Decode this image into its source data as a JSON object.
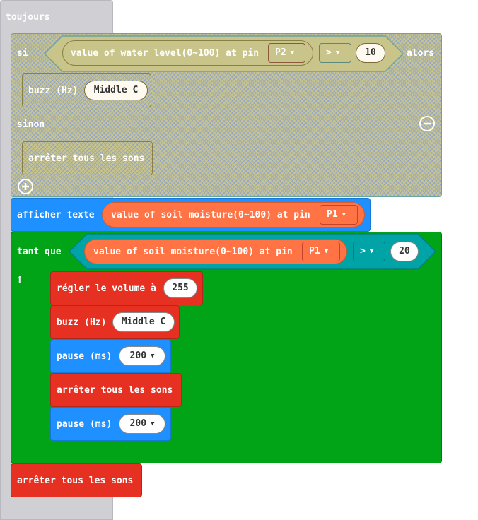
{
  "blocks": {
    "forever": {
      "label": "toujours"
    },
    "if_block": {
      "if_label": "si",
      "then_label": "alors",
      "else_label": "sinon",
      "condition": {
        "sensor_label": "value of water level(0~100) at pin",
        "pin": "P2",
        "operator": ">",
        "value": "10"
      },
      "then_buzz": {
        "label": "buzz (Hz)",
        "note": "Middle C"
      },
      "else_stop": {
        "label": "arrêter tous les sons"
      },
      "minus_icon": "minus-circle-icon",
      "plus_icon": "plus-circle-icon"
    },
    "show_text": {
      "label": "afficher texte",
      "sensor_label": "value of soil moisture(0~100) at pin",
      "pin": "P1"
    },
    "while_block": {
      "label": "tant que",
      "do_label": "faire",
      "condition": {
        "sensor_label": "value of soil moisture(0~100) at pin",
        "pin": "P1",
        "operator": ">",
        "value": "20"
      },
      "body": {
        "set_volume": {
          "label": "régler le volume à",
          "value": "255"
        },
        "buzz": {
          "label": "buzz (Hz)",
          "note": "Middle C"
        },
        "pause1": {
          "label": "pause (ms)",
          "value": "200"
        },
        "stop": {
          "label": "arrêter tous les sons"
        },
        "pause2": {
          "label": "pause (ms)",
          "value": "200"
        }
      }
    },
    "final_stop": {
      "label": "arrêter tous les sons"
    }
  },
  "colors": {
    "forever": "#d0d0d4",
    "logic_hatched": "#c9c48a",
    "basic": "#1e90ff",
    "loops": "#00a416",
    "music": "#e63022",
    "sensor": "#ff7345",
    "compare": "#00a4a6"
  }
}
